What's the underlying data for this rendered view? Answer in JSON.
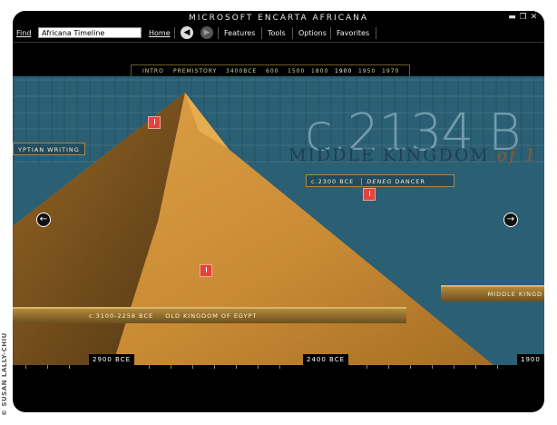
{
  "window": {
    "title": "MICROSOFT ENCARTA AFRICANA",
    "controls": [
      "minimize-icon",
      "restore-icon",
      "close-icon"
    ]
  },
  "menu": {
    "find_label": "Find",
    "find_value": "Africana Timeline",
    "home": "Home",
    "features": "Features",
    "tools": "Tools",
    "options": "Options",
    "favorites": "Favorites"
  },
  "timeline": {
    "eras": [
      "INTRO",
      "PREMISTORY",
      "3400BCE",
      "600",
      "1500",
      "1800",
      "1900",
      "1950",
      "1970"
    ],
    "active_era": "1900"
  },
  "scene": {
    "big_date": "c.2134 B",
    "kingdom_heading": "MIDDLE KINGDOM",
    "kingdom_suffix": "of 1",
    "left_label": "YPTIAN WRITING",
    "event_date": "c.2300 BCE",
    "event_name_italic": "DENEG",
    "event_name": "DANCER",
    "old_kingdom_date": "c.3100-2258 BCE",
    "old_kingdom_name": "OLD KINGDOM OF EGYPT",
    "middle_kingdom_band": "MIDDLE KINGD"
  },
  "ruler": {
    "labels": [
      "2900 BCE",
      "2400 BCE",
      "1900"
    ]
  },
  "credit": "© SUSAN LALLY-CHIU",
  "colors": {
    "sky": "#2b5f74",
    "hotspot": "#e0443c",
    "band_gold": "#b38a3b",
    "era_marker": "#e6c238"
  }
}
